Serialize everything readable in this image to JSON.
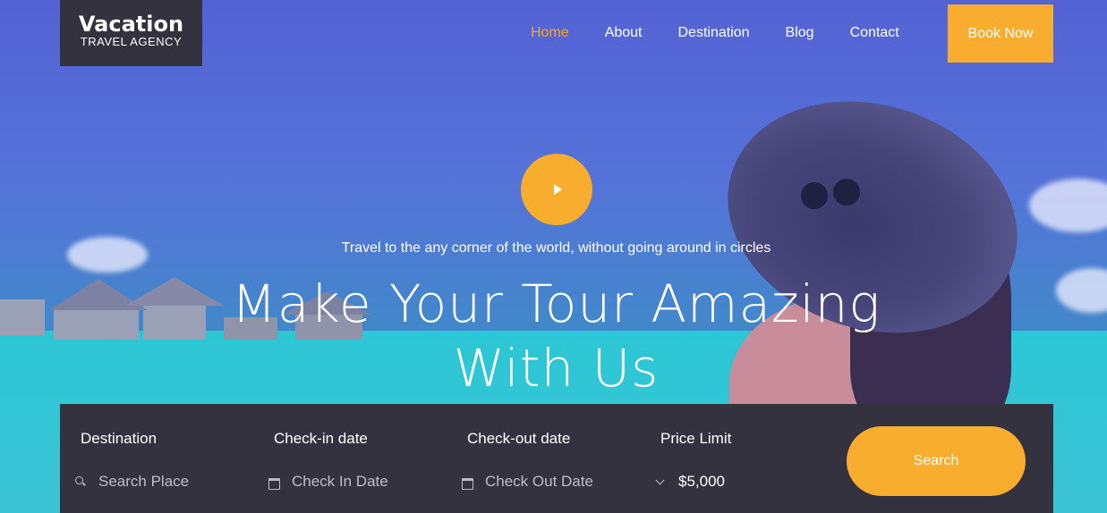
{
  "brand": {
    "title": "Vacation",
    "subtitle": "TRAVEL AGENCY"
  },
  "nav": {
    "items": [
      {
        "label": "Home",
        "active": true
      },
      {
        "label": "About"
      },
      {
        "label": "Destination"
      },
      {
        "label": "Blog"
      },
      {
        "label": "Contact"
      }
    ],
    "cta": "Book Now"
  },
  "hero": {
    "tagline": "Travel to the any corner of the world, without going around in circles",
    "headline_line1": "Make Your Tour Amazing",
    "headline_line2": "With Us",
    "play_icon": "play-icon"
  },
  "search": {
    "fields": [
      {
        "label": "Destination",
        "placeholder": "Search Place",
        "icon": "search-icon"
      },
      {
        "label": "Check-in date",
        "placeholder": "Check In Date",
        "icon": "calendar-icon"
      },
      {
        "label": "Check-out date",
        "placeholder": "Check Out Date",
        "icon": "calendar-icon"
      },
      {
        "label": "Price Limit",
        "value": "$5,000",
        "icon": "chevron-down-icon"
      }
    ],
    "button": "Search"
  },
  "colors": {
    "accent": "#f9ad2e",
    "dark": "#34323f",
    "active_nav": "#f9a826"
  }
}
